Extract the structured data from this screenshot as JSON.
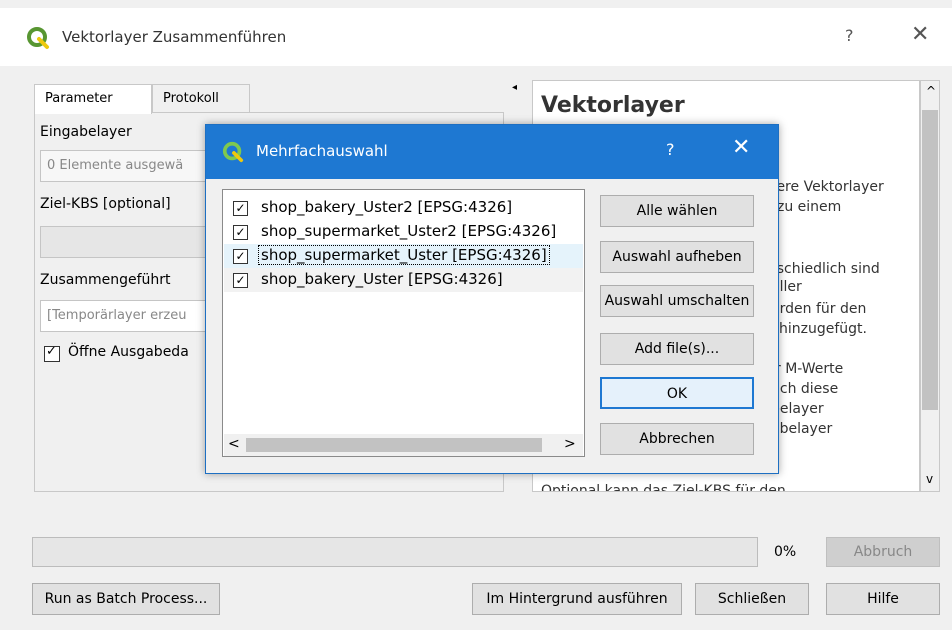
{
  "window": {
    "title": "Vektorlayer Zusammenführen",
    "help_glyph": "?",
    "close_glyph": "✕",
    "tabs": [
      "Parameter",
      "Protokoll"
    ],
    "params": {
      "input_label": "Eingabelayer",
      "input_value": "0 Elemente ausgewä",
      "crs_label": "Ziel-KBS [optional]",
      "crs_value": "",
      "output_label": "Zusammengeführt",
      "output_placeholder": "[Temporärlayer erzeu",
      "open_output_label": "Öffne Ausgabeda",
      "open_output_checked": true
    },
    "help": {
      "title": "Vektorlayer",
      "lines": [
        "rere Vektorlayer",
        "zu einem",
        "",
        "rschiedlich sind",
        "aller",
        "erden für den",
        "hinzugefügt.",
        "",
        "r M-Werte",
        "uch diese",
        "belayer",
        "abelayer"
      ],
      "footer": "Optional kann das Ziel-KBS für den"
    },
    "progress_text": "0%",
    "progress_value": 0,
    "buttons": {
      "abbruch": "Abbruch",
      "batch": "Run as Batch Process...",
      "background": "Im Hintergrund ausführen",
      "close": "Schließen",
      "help": "Hilfe"
    }
  },
  "dialog": {
    "title": "Mehrfachauswahl",
    "help_glyph": "?",
    "close_glyph": "✕",
    "items": [
      {
        "label": "shop_bakery_Uster2 [EPSG:4326]",
        "checked": true
      },
      {
        "label": "shop_supermarket_Uster2 [EPSG:4326]",
        "checked": true
      },
      {
        "label": "shop_supermarket_Uster [EPSG:4326]",
        "checked": true,
        "selected": true
      },
      {
        "label": "shop_bakery_Uster [EPSG:4326]",
        "checked": true
      }
    ],
    "buttons": {
      "select_all": "Alle wählen",
      "deselect": "Auswahl aufheben",
      "toggle": "Auswahl umschalten",
      "add_files": "Add file(s)...",
      "ok": "OK",
      "cancel": "Abbrechen"
    },
    "scroll_left": "<",
    "scroll_right": ">"
  },
  "icons": {
    "app": "qgis-icon",
    "check": "✓",
    "collapse": "◂",
    "scroll_up": "^",
    "scroll_down": "v"
  },
  "colors": {
    "dialog_titlebar": "#1e78d2",
    "selection": "#e5f3fb",
    "qgis_green": "#589632",
    "qgis_yellow": "#eec90d"
  }
}
